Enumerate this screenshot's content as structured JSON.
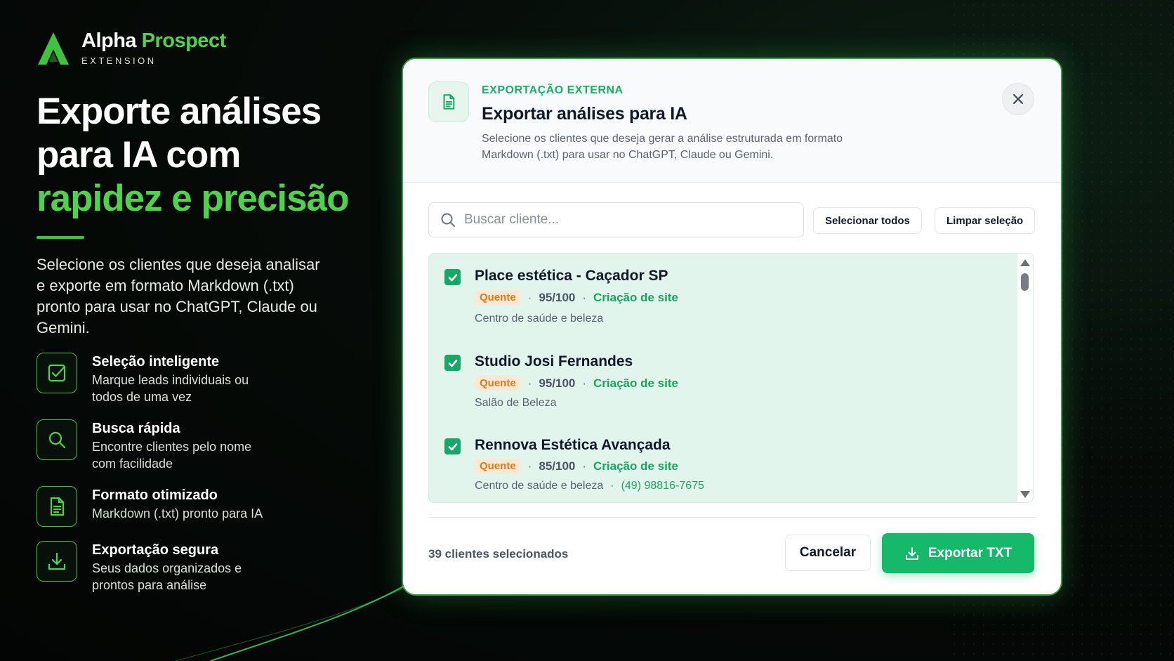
{
  "brand": {
    "name_primary": "Alpha",
    "name_accent": "Prospect",
    "subtitle": "EXTENSION"
  },
  "hero": {
    "headline_line1": "Exporte análises",
    "headline_line2": "para IA com",
    "headline_accent": "rapidez e precisão",
    "lead": "Selecione os clientes que deseja analisar e exporte em formato Markdown (.txt) pronto para usar no ChatGPT, Claude ou Gemini."
  },
  "features": [
    {
      "icon": "check-square-icon",
      "title": "Seleção inteligente",
      "desc": "Marque leads individuais ou todos de uma vez"
    },
    {
      "icon": "search-icon",
      "title": "Busca rápida",
      "desc": "Encontre clientes pelo nome com facilidade"
    },
    {
      "icon": "document-icon",
      "title": "Formato otimizado",
      "desc": "Markdown (.txt) pronto para IA"
    },
    {
      "icon": "download-icon",
      "title": "Exportação segura",
      "desc": "Seus dados organizados e prontos para análise"
    }
  ],
  "modal": {
    "eyebrow": "EXPORTAÇÃO EXTERNA",
    "title": "Exportar análises para IA",
    "description": "Selecione os clientes que deseja gerar a análise estruturada em formato Markdown (.txt) para usar no ChatGPT, Claude ou Gemini.",
    "search_placeholder": "Buscar cliente...",
    "select_all_label": "Selecionar todos",
    "clear_label": "Limpar seleção",
    "clients": [
      {
        "name": "Place estética - Caçador SP",
        "temperature": "Quente",
        "score": "95/100",
        "service": "Criação de site",
        "category": "Centro de saúde e beleza",
        "phone": "",
        "checked": true
      },
      {
        "name": "Studio Josi Fernandes",
        "temperature": "Quente",
        "score": "95/100",
        "service": "Criação de site",
        "category": "Salão de Beleza",
        "phone": "",
        "checked": true
      },
      {
        "name": "Rennova Estética Avançada",
        "temperature": "Quente",
        "score": "85/100",
        "service": "Criação de site",
        "category": "Centro de saúde e beleza",
        "phone": "(49) 98816-7675",
        "checked": true
      }
    ],
    "selected_count": "39 clientes selecionados",
    "cancel_label": "Cancelar",
    "export_label": "Exportar TXT"
  },
  "colors": {
    "accent": "#4ed34a",
    "primary_button": "#16b86a",
    "hot_tag_bg": "#fde8d4",
    "hot_tag_text": "#e07a17",
    "list_bg": "#e2f5ec"
  }
}
